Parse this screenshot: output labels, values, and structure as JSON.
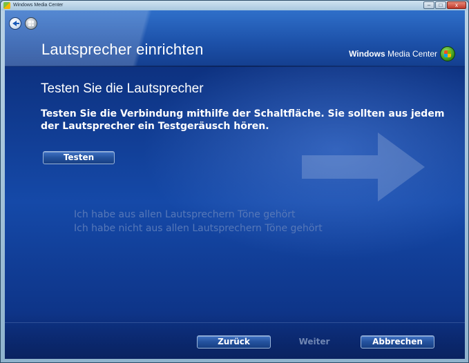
{
  "window": {
    "title": "Windows Media Center",
    "controls": {
      "minimize": "–",
      "maximize": "□",
      "close": "x"
    }
  },
  "header": {
    "title": "Lautsprecher einrichten",
    "brand_bold": "Windows",
    "brand_rest": " Media Center"
  },
  "content": {
    "heading": "Testen Sie die Lautsprecher",
    "instructions": "Testen Sie die Verbindung mithilfe der Schaltfläche. Sie sollten aus jedem der Lautsprecher ein Testgeräusch hören.",
    "test_button": "Testen",
    "options": [
      "Ich habe aus allen Lautsprechern Töne gehört",
      "Ich habe nicht aus allen Lautsprechern Töne gehört"
    ]
  },
  "footer": {
    "back": "Zurück",
    "next": "Weiter",
    "cancel": "Abbrechen"
  },
  "icons": {
    "back": "back-arrow-icon",
    "start": "windows-start-icon",
    "brand": "media-center-logo-icon"
  },
  "colors": {
    "background": "#0d2d77",
    "header": "#1c50a8",
    "text": "#ffffff",
    "disabled_text": "#5778b8"
  }
}
